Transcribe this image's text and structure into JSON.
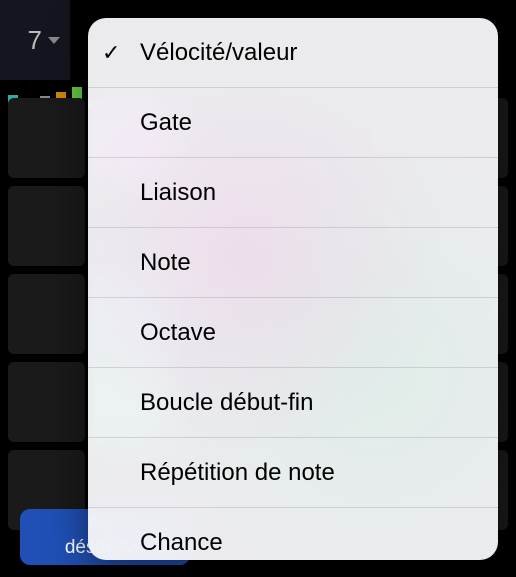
{
  "header": {
    "value": "7"
  },
  "bottom_button": {
    "label": "Pas\ndésactivé"
  },
  "menu": {
    "items": [
      {
        "label": "Vélocité/valeur",
        "selected": true
      },
      {
        "label": "Gate",
        "selected": false
      },
      {
        "label": "Liaison",
        "selected": false
      },
      {
        "label": "Note",
        "selected": false
      },
      {
        "label": "Octave",
        "selected": false
      },
      {
        "label": "Boucle début-fin",
        "selected": false
      },
      {
        "label": "Répétition de note",
        "selected": false
      },
      {
        "label": "Chance",
        "selected": false
      }
    ]
  },
  "checkmark": "✓"
}
